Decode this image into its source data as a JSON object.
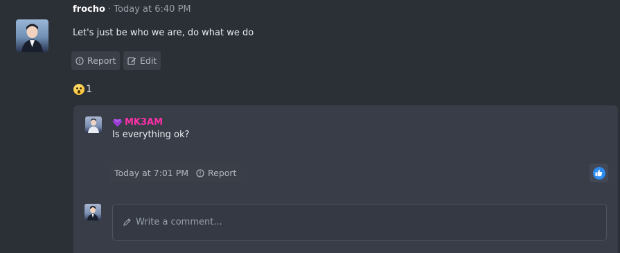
{
  "post": {
    "username": "frocho",
    "separator": "·",
    "timestamp": "Today at 6:40 PM",
    "body": "Let's just be who we are, do what we do",
    "actions": {
      "report_label": "Report",
      "edit_label": "Edit"
    },
    "reaction": {
      "emoji": "astonished-face",
      "count": "1"
    }
  },
  "comment": {
    "author": "MK3AM",
    "body": "Is everything ok?",
    "timestamp": "Today at 7:01 PM",
    "report_label": "Report",
    "like_icon": "thumbs-up-icon"
  },
  "composer": {
    "placeholder": "Write a comment..."
  },
  "colors": {
    "background": "#2b2f36",
    "panel": "#383d47",
    "author_accent": "#ff2fa8",
    "like": "#2d8cf0"
  }
}
